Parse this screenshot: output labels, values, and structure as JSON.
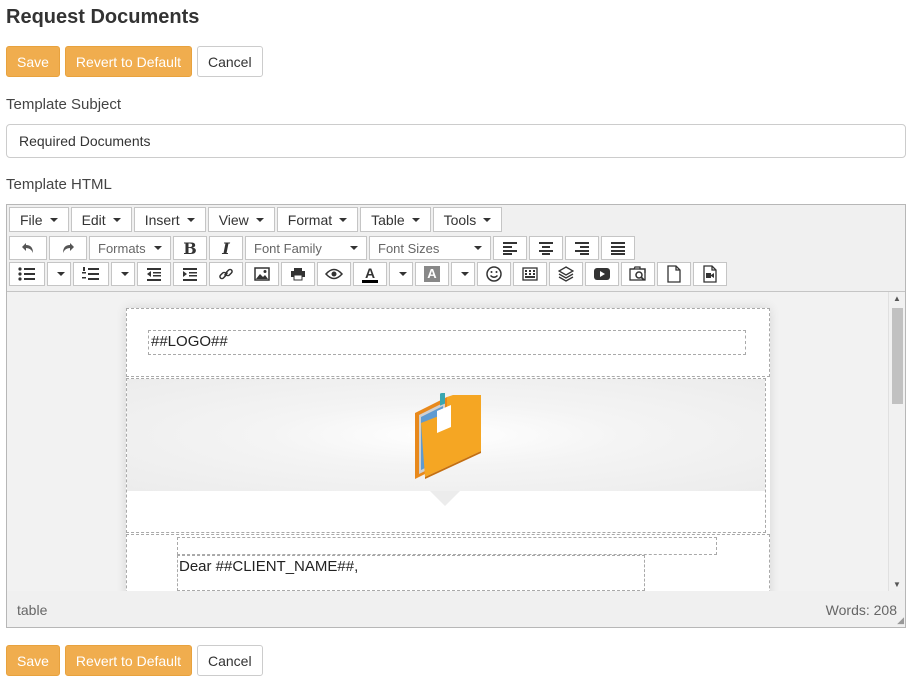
{
  "page": {
    "title": "Request Documents"
  },
  "top_buttons": {
    "save": "Save",
    "revert": "Revert to Default",
    "cancel": "Cancel"
  },
  "bottom_buttons": {
    "save": "Save",
    "revert": "Revert to Default",
    "cancel": "Cancel"
  },
  "subject": {
    "label": "Template Subject",
    "value": "Required Documents"
  },
  "html_section": {
    "label": "Template HTML"
  },
  "editor": {
    "menus": [
      "File",
      "Edit",
      "Insert",
      "View",
      "Format",
      "Table",
      "Tools"
    ],
    "formats_label": "Formats",
    "font_family_label": "Font Family",
    "font_sizes_label": "Font Sizes",
    "text_color_glyph": "A",
    "bg_color_glyph": "A",
    "bold_glyph": "B",
    "italic_glyph": "I",
    "content": {
      "logo_placeholder": "##LOGO##",
      "greeting": "Dear ##CLIENT_NAME##,"
    },
    "status": {
      "path": "table",
      "word_count": "Words: 208"
    }
  },
  "colors": {
    "accent": "#f0ad4e",
    "folder": "#f5a623"
  }
}
